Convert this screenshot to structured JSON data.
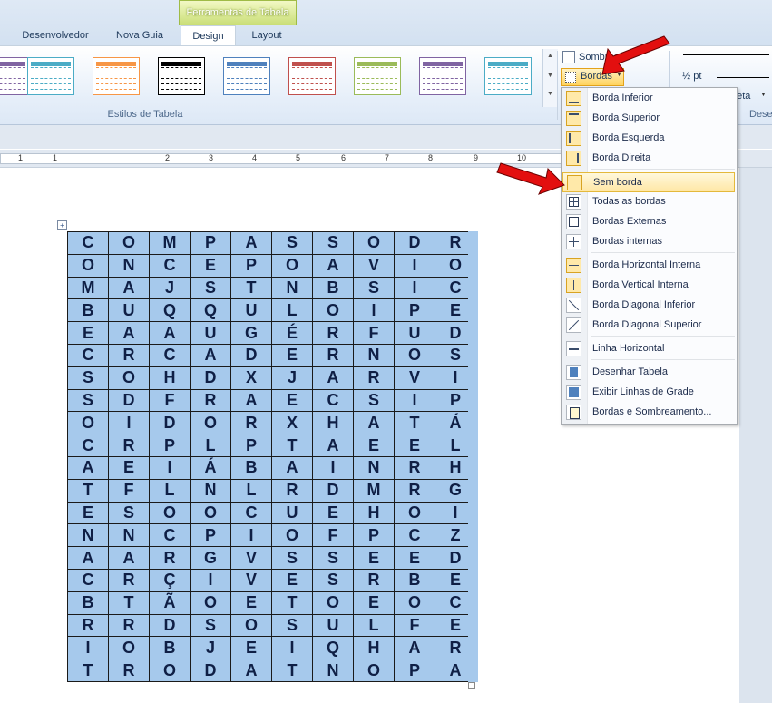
{
  "ribbon": {
    "contextual_group": "Ferramentas de Tabela",
    "tabs": [
      "Desenvolvedor",
      "Nova Guia",
      "Design",
      "Layout"
    ],
    "active_tab": "Design",
    "group_label": "Estilos de Tabela",
    "group_label_right": "Dese",
    "shading_label": "Sombream",
    "borders_label": "Bordas",
    "pen_weight": "½ pt",
    "pen_color_label": "neta"
  },
  "table_styles": [
    {
      "color": "#8064a2"
    },
    {
      "color": "#4bacc6"
    },
    {
      "color": "#f79646"
    },
    {
      "color": "#000000"
    },
    {
      "color": "#4f81bd"
    },
    {
      "color": "#c0504d"
    },
    {
      "color": "#9bbb59"
    },
    {
      "color": "#8064a2"
    },
    {
      "color": "#4bacc6"
    }
  ],
  "ruler": [
    "1",
    "1",
    "2",
    "3",
    "4",
    "5",
    "6",
    "7",
    "8",
    "9",
    "10"
  ],
  "borders_menu": {
    "items": [
      {
        "label": "Borda Inferior",
        "icon": "border-bottom-icon"
      },
      {
        "label": "Borda Superior",
        "icon": "border-top-icon"
      },
      {
        "label": "Borda Esquerda",
        "icon": "border-left-icon"
      },
      {
        "label": "Borda Direita",
        "icon": "border-right-icon"
      },
      {
        "label": "Sem borda",
        "icon": "no-border-icon"
      },
      {
        "label": "Todas as bordas",
        "icon": "all-borders-icon"
      },
      {
        "label": "Bordas Externas",
        "icon": "outside-borders-icon"
      },
      {
        "label": "Bordas internas",
        "icon": "inside-borders-icon"
      },
      {
        "label": "Borda Horizontal Interna",
        "icon": "inside-horizontal-border-icon"
      },
      {
        "label": "Borda Vertical Interna",
        "icon": "inside-vertical-border-icon"
      },
      {
        "label": "Borda Diagonal Inferior",
        "icon": "diagonal-down-border-icon"
      },
      {
        "label": "Borda Diagonal Superior",
        "icon": "diagonal-up-border-icon"
      },
      {
        "label": "Linha Horizontal",
        "icon": "horizontal-line-icon"
      },
      {
        "label": "Desenhar Tabela",
        "icon": "draw-table-icon"
      },
      {
        "label": "Exibir Linhas de Grade",
        "icon": "view-gridlines-icon"
      },
      {
        "label": "Bordas e Sombreamento...",
        "icon": "borders-shading-icon"
      }
    ],
    "highlighted": "Sem borda"
  },
  "word_search": [
    [
      "C",
      "O",
      "M",
      "P",
      "A",
      "S",
      "S",
      "O",
      "D",
      "R"
    ],
    [
      "O",
      "N",
      "C",
      "E",
      "P",
      "O",
      "A",
      "V",
      "I",
      "O"
    ],
    [
      "M",
      "A",
      "J",
      "S",
      "T",
      "N",
      "B",
      "S",
      "I",
      "C"
    ],
    [
      "B",
      "U",
      "Q",
      "Q",
      "U",
      "L",
      "O",
      "I",
      "P",
      "E"
    ],
    [
      "E",
      "A",
      "A",
      "U",
      "G",
      "É",
      "R",
      "F",
      "U",
      "D"
    ],
    [
      "C",
      "R",
      "C",
      "A",
      "D",
      "E",
      "R",
      "N",
      "O",
      "S"
    ],
    [
      "S",
      "O",
      "H",
      "D",
      "X",
      "J",
      "A",
      "R",
      "V",
      "I"
    ],
    [
      "S",
      "D",
      "F",
      "R",
      "A",
      "E",
      "C",
      "S",
      "I",
      "P"
    ],
    [
      "O",
      "I",
      "D",
      "O",
      "R",
      "X",
      "H",
      "A",
      "T",
      "Á"
    ],
    [
      "C",
      "R",
      "P",
      "L",
      "P",
      "T",
      "A",
      "E",
      "E",
      "L"
    ],
    [
      "A",
      "E",
      "I",
      "Á",
      "B",
      "A",
      "I",
      "N",
      "R",
      "H"
    ],
    [
      "T",
      "F",
      "L",
      "N",
      "L",
      "R",
      "D",
      "M",
      "R",
      "G"
    ],
    [
      "E",
      "S",
      "O",
      "O",
      "C",
      "U",
      "E",
      "H",
      "O",
      "I"
    ],
    [
      "N",
      "N",
      "C",
      "P",
      "I",
      "O",
      "F",
      "P",
      "C",
      "Z"
    ],
    [
      "A",
      "A",
      "R",
      "G",
      "V",
      "S",
      "S",
      "E",
      "E",
      "D"
    ],
    [
      "C",
      "R",
      "Ç",
      "I",
      "V",
      "E",
      "S",
      "R",
      "B",
      "E"
    ],
    [
      "B",
      "T",
      "Ã",
      "O",
      "E",
      "T",
      "O",
      "E",
      "O",
      "C"
    ],
    [
      "R",
      "R",
      "D",
      "S",
      "O",
      "S",
      "U",
      "L",
      "F",
      "E"
    ],
    [
      "I",
      "O",
      "B",
      "J",
      "E",
      "I",
      "Q",
      "H",
      "A",
      "R"
    ],
    [
      "T",
      "R",
      "O",
      "D",
      "A",
      "T",
      "N",
      "O",
      "P",
      "A"
    ]
  ]
}
